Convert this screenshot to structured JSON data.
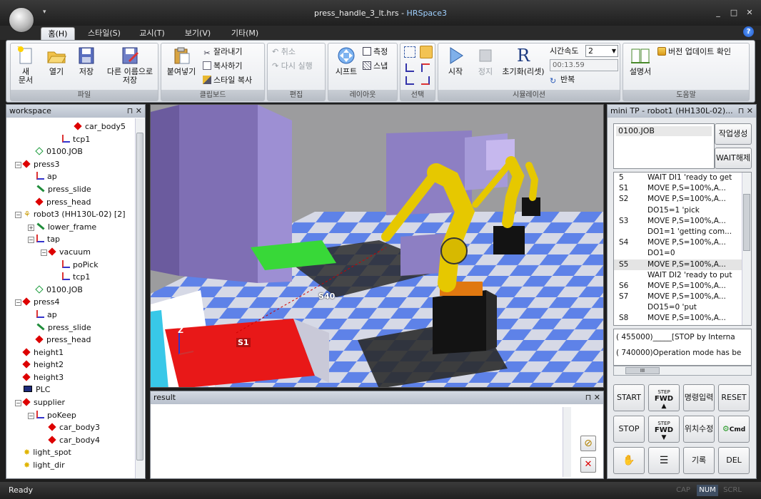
{
  "window": {
    "title_file": "press_handle_3_lt.hrs",
    "title_sep": " - ",
    "title_app": "HRSpace3",
    "minimize": "_",
    "maximize": "□",
    "close": "✕",
    "qat_arrow": "▾"
  },
  "ribbon_tabs": [
    {
      "label": "홈(H)",
      "active": true
    },
    {
      "label": "스타일(S)",
      "active": false
    },
    {
      "label": "교시(T)",
      "active": false
    },
    {
      "label": "보기(V)",
      "active": false
    },
    {
      "label": "기타(M)",
      "active": false
    }
  ],
  "help": "?",
  "ribbon": {
    "file": {
      "caption": "파일",
      "new": "새\n문서",
      "open": "열기",
      "save": "저장",
      "save_as": "다른 이름으로\n저장"
    },
    "clipboard": {
      "caption": "클립보드",
      "paste": "붙여넣기",
      "cut": "잘라내기",
      "copy": "복사하기",
      "style_copy": "스타일 복사"
    },
    "edit": {
      "caption": "편집",
      "undo": "취소",
      "redo": "다시 실행"
    },
    "layout": {
      "caption": "레이아웃",
      "shift": "시프트",
      "measure": "측정",
      "snap": "스냅"
    },
    "select": {
      "caption": "선택"
    },
    "simulation": {
      "caption": "시뮬레이션",
      "start": "시작",
      "stop": "정지",
      "reset": "초기화(리셋)",
      "speed_label": "시간속도",
      "speed_value": "2",
      "time": "00:13.59",
      "repeat": "반복"
    },
    "help": {
      "caption": "도움말",
      "manual": "설명서",
      "update": "버전 업데이트 확인"
    }
  },
  "workspace": {
    "title": "workspace",
    "pin": "⊓",
    "close": "✕",
    "tree": [
      {
        "label": "car_body5",
        "indent": 5,
        "icon": "diamond"
      },
      {
        "label": "tcp1",
        "indent": 4,
        "icon": "tcp"
      },
      {
        "label": "0100.JOB",
        "indent": 2,
        "icon": "job"
      },
      {
        "label": "press3",
        "indent": 1,
        "icon": "diamond",
        "exp": "−"
      },
      {
        "label": "ap",
        "indent": 2,
        "icon": "tcp"
      },
      {
        "label": "press_slide",
        "indent": 2,
        "icon": "bar"
      },
      {
        "label": "press_head",
        "indent": 2,
        "icon": "diamond"
      },
      {
        "label": "robot3 (HH130L-02) [2]",
        "indent": 1,
        "icon": "robot",
        "exp": "−"
      },
      {
        "label": "lower_frame",
        "indent": 2,
        "icon": "bar",
        "exp": "+"
      },
      {
        "label": "tap",
        "indent": 2,
        "icon": "tcp",
        "exp": "−"
      },
      {
        "label": "vacuum",
        "indent": 3,
        "icon": "diamond",
        "exp": "−"
      },
      {
        "label": "poPick",
        "indent": 4,
        "icon": "tcp"
      },
      {
        "label": "tcp1",
        "indent": 4,
        "icon": "tcp"
      },
      {
        "label": "0100.JOB",
        "indent": 2,
        "icon": "job"
      },
      {
        "label": "press4",
        "indent": 1,
        "icon": "diamond",
        "exp": "−"
      },
      {
        "label": "ap",
        "indent": 2,
        "icon": "tcp"
      },
      {
        "label": "press_slide",
        "indent": 2,
        "icon": "bar"
      },
      {
        "label": "press_head",
        "indent": 2,
        "icon": "diamond"
      },
      {
        "label": "height1",
        "indent": 1,
        "icon": "diamond"
      },
      {
        "label": "height2",
        "indent": 1,
        "icon": "diamond"
      },
      {
        "label": "height3",
        "indent": 1,
        "icon": "diamond"
      },
      {
        "label": "PLC",
        "indent": 1,
        "icon": "plc"
      },
      {
        "label": "supplier",
        "indent": 1,
        "icon": "diamond",
        "exp": "−"
      },
      {
        "label": "poKeep",
        "indent": 2,
        "icon": "tcp",
        "exp": "−"
      },
      {
        "label": "car_body3",
        "indent": 3,
        "icon": "diamond"
      },
      {
        "label": "car_body4",
        "indent": 3,
        "icon": "diamond"
      },
      {
        "label": "light_spot",
        "indent": 1,
        "icon": "light"
      },
      {
        "label": "light_dir",
        "indent": 1,
        "icon": "light"
      }
    ]
  },
  "viewport": {
    "label_s40": "S40",
    "label_s1": "S1",
    "axis_z": "Z"
  },
  "result": {
    "title": "result",
    "pin": "⊓",
    "close": "✕"
  },
  "minitp": {
    "title": "mini TP - robot1 (HH130L-02)...",
    "pin": "⊓",
    "close": "✕",
    "job": "0100.JOB",
    "btn_create": "작업생성",
    "btn_wait": "WAIT해제",
    "program": [
      {
        "step": "5",
        "text": "WAIT DI1 'ready to get"
      },
      {
        "step": "S1",
        "text": "MOVE P,S=100%,A..."
      },
      {
        "step": "S2",
        "text": "MOVE P,S=100%,A..."
      },
      {
        "step": "",
        "text": "DO15=1 'pick"
      },
      {
        "step": "S3",
        "text": "MOVE P,S=100%,A..."
      },
      {
        "step": "",
        "text": "DO1=1 'getting com..."
      },
      {
        "step": "S4",
        "text": "MOVE P,S=100%,A..."
      },
      {
        "step": "",
        "text": "DO1=0"
      },
      {
        "step": "S5",
        "text": "MOVE P,S=100%,A...",
        "selected": true
      },
      {
        "step": "",
        "text": "WAIT DI2 'ready to put"
      },
      {
        "step": "S6",
        "text": "MOVE P,S=100%,A..."
      },
      {
        "step": "S7",
        "text": "MOVE P,S=100%,A..."
      },
      {
        "step": "",
        "text": "DO15=0 'put"
      },
      {
        "step": "S8",
        "text": "MOVE P,S=100%,A..."
      }
    ],
    "log": [
      "( 455000)_____[STOP by Interna",
      "( 740000)Operation mode has be"
    ],
    "hscroll_grip": "III",
    "buttons": {
      "start": "START",
      "step_label": "STEP",
      "fwd": "FWD",
      "cmd_input": "명령입력",
      "reset": "RESET",
      "stop": "STOP",
      "pos_edit": "위치수정",
      "cmd": "Cmd",
      "record": "기록",
      "del": "DEL"
    }
  },
  "status": {
    "text": "Ready",
    "cap": "CAP",
    "num": "NUM",
    "scrl": "SCRL"
  }
}
